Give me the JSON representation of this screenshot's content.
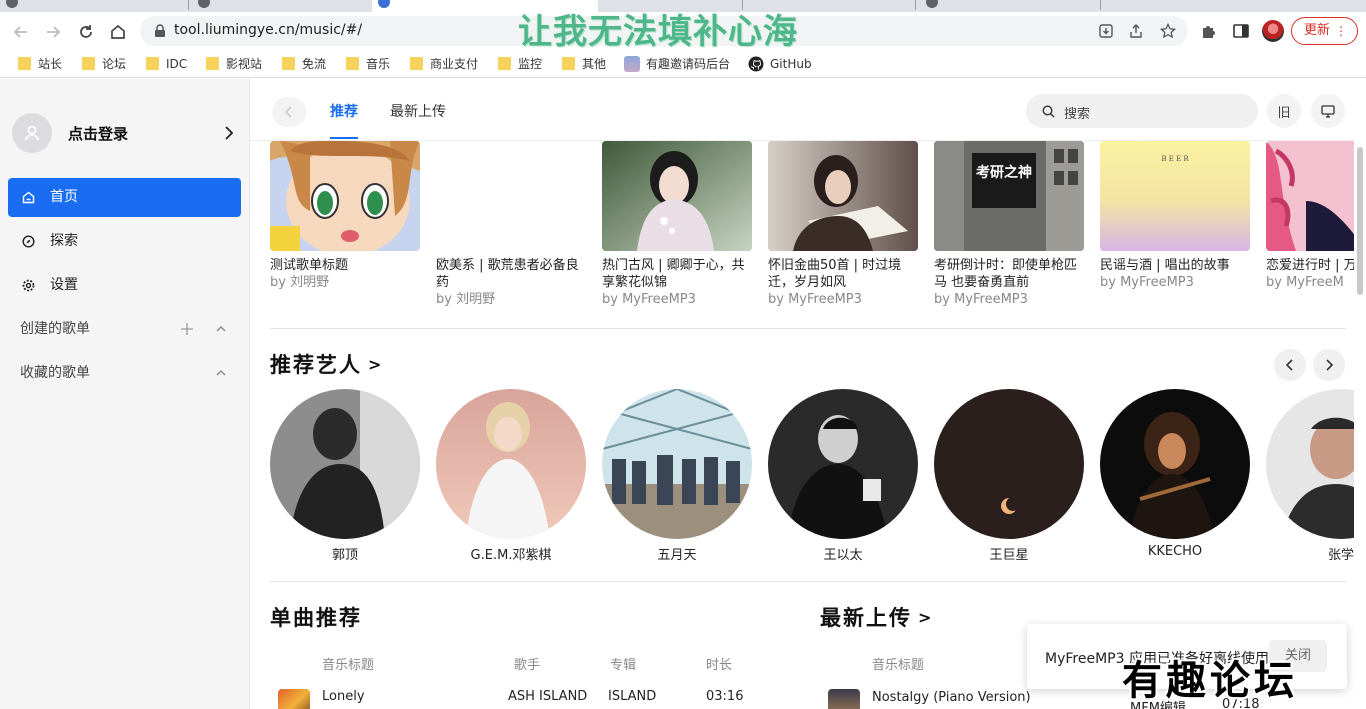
{
  "browser": {
    "url": "tool.liumingye.cn/music/#/",
    "update_label": "更新",
    "watermark_top": "让我无法填补心海",
    "bookmarks": [
      {
        "label": "站长",
        "type": "folder"
      },
      {
        "label": "论坛",
        "type": "folder"
      },
      {
        "label": "IDC",
        "type": "folder"
      },
      {
        "label": "影视站",
        "type": "folder"
      },
      {
        "label": "免流",
        "type": "folder"
      },
      {
        "label": "音乐",
        "type": "folder"
      },
      {
        "label": "商业支付",
        "type": "folder"
      },
      {
        "label": "监控",
        "type": "folder"
      },
      {
        "label": "其他",
        "type": "folder"
      },
      {
        "label": "有趣邀请码后台",
        "type": "image"
      },
      {
        "label": "GitHub",
        "type": "github"
      }
    ]
  },
  "sidebar": {
    "login_label": "点击登录",
    "nav": [
      {
        "label": "首页",
        "icon": "home-icon",
        "active": true
      },
      {
        "label": "探索",
        "icon": "compass-icon",
        "active": false
      },
      {
        "label": "设置",
        "icon": "gear-icon",
        "active": false
      }
    ],
    "created_playlists": "创建的歌单",
    "favorite_playlists": "收藏的歌单"
  },
  "topbar": {
    "tabs": [
      "推荐",
      "最新上传"
    ],
    "search_placeholder": "搜索",
    "old_label": "旧"
  },
  "playlists": [
    {
      "name": "测试歌单标题",
      "by": "by 刘明野"
    },
    {
      "name": "欧美系 | 歌荒患者必备良药",
      "by": "by 刘明野"
    },
    {
      "name": "热门古风 | 卿卿于心，共享繁花似锦",
      "by": "by MyFreeMP3"
    },
    {
      "name": "怀旧金曲50首 | 时过境迁，岁月如风",
      "by": "by MyFreeMP3"
    },
    {
      "name": "考研倒计时：即使单枪匹马 也要奋勇直前",
      "by": "by MyFreeMP3"
    },
    {
      "name": "民谣与酒 | 唱出的故事",
      "by": "by MyFreeMP3"
    },
    {
      "name": "恋爱进行时 | 万种可能",
      "by": "by MyFreeM"
    }
  ],
  "cover_text": {
    "kaoyan": "考研之神",
    "beer": "B  E  E  R"
  },
  "artists_title": "推荐艺人",
  "artists": [
    "郭顶",
    "G.E.M.邓紫棋",
    "五月天",
    "王以太",
    "王巨星",
    "KKECHO",
    "张学"
  ],
  "songs_title": "单曲推荐",
  "latest_title": "最新上传",
  "song_columns": [
    "音乐标题",
    "歌手",
    "专辑",
    "时长"
  ],
  "latest_columns": [
    "音乐标题"
  ],
  "song_row": {
    "title": "Lonely",
    "singer": "ASH ISLAND",
    "album": "ISLAND",
    "duration": "03:16"
  },
  "latest_row": {
    "title": "Nostalgy (Piano Version)",
    "singer": "MFM编辑",
    "duration": "07:18"
  },
  "toast": {
    "message": "MyFreeMP3 应用已准备好离线使用",
    "close_label": "关闭"
  },
  "watermark_bottom": "有趣论坛",
  "colors": {
    "accent": "#1a6df2",
    "sidebar_bg": "#f5f5f6"
  }
}
